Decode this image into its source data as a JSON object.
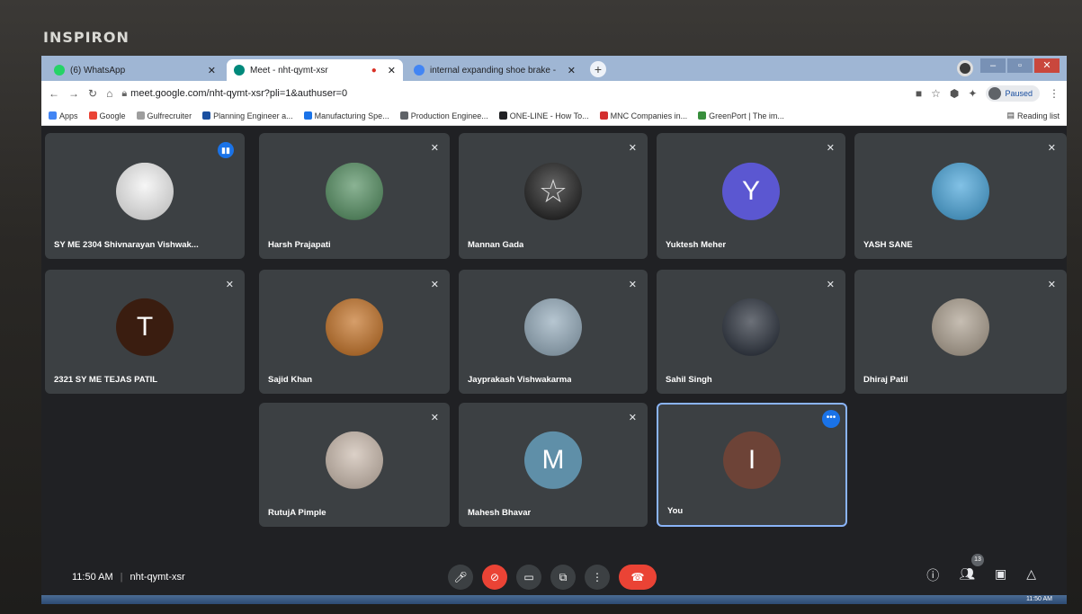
{
  "device": {
    "brand": "INSPIRON"
  },
  "browser": {
    "tabs": [
      {
        "title": "(6) WhatsApp",
        "color": "#25d366"
      },
      {
        "title": "Meet - nht-qymt-xsr",
        "color": "#00897b",
        "recording": "●"
      },
      {
        "title": "internal expanding shoe brake - ",
        "color": "#4285f4"
      }
    ],
    "url": "meet.google.com/nht-qymt-xsr?pli=1&authuser=0",
    "profile_status": "Paused",
    "bookmarks": [
      {
        "label": "Apps",
        "color": "#4285f4"
      },
      {
        "label": "Google",
        "color": "#ea4335"
      },
      {
        "label": "Gulfrecruiter",
        "color": "#9e9e9e"
      },
      {
        "label": "Planning Engineer a...",
        "color": "#1a4fa0"
      },
      {
        "label": "Manufacturing Spe...",
        "color": "#1a73e8"
      },
      {
        "label": "Production Enginee...",
        "color": "#5f6368"
      },
      {
        "label": "ONE-LINE - How To...",
        "color": "#202124"
      },
      {
        "label": "MNC Companies in...",
        "color": "#d32f2f"
      },
      {
        "label": "GreenPort | The im...",
        "color": "#388e3c"
      }
    ],
    "reading_list": "Reading list"
  },
  "meet": {
    "participants": [
      {
        "name": "SY ME 2304 Shivnarayan Vishwak...",
        "avatar": "photo",
        "color": "#f2f2f2",
        "status": "speaking"
      },
      {
        "name": "Harsh Prajapati",
        "avatar": "photo",
        "color": "#4c8a5a",
        "status": "muted"
      },
      {
        "name": "Mannan Gada",
        "avatar": "star-photo",
        "color": "#111111",
        "status": "muted"
      },
      {
        "name": "Yuktesh Meher",
        "avatar": "Y",
        "color": "#5b57d1",
        "status": "muted"
      },
      {
        "name": "YASH SANE",
        "avatar": "photo",
        "color": "#3fa0d8",
        "status": "muted"
      },
      {
        "name": "2321 SY ME TEJAS PATIL",
        "avatar": "T",
        "color": "#3a1d10",
        "status": "muted"
      },
      {
        "name": "Sajid Khan",
        "avatar": "photo",
        "color": "#c06a1a",
        "status": "muted"
      },
      {
        "name": "Jayprakash Vishwakarma",
        "avatar": "photo",
        "color": "#8fa7b8",
        "status": "muted"
      },
      {
        "name": "Sahil Singh",
        "avatar": "photo",
        "color": "#1d2430",
        "status": "muted"
      },
      {
        "name": "Dhiraj Patil",
        "avatar": "photo",
        "color": "#a89b8a",
        "status": "muted"
      },
      {
        "name": "RutujA Pimple",
        "avatar": "photo",
        "color": "#c9b8aa",
        "status": "muted"
      },
      {
        "name": "Mahesh Bhavar",
        "avatar": "M",
        "color": "#5f8fa8",
        "status": "muted"
      },
      {
        "name": "You",
        "avatar": "I",
        "color": "#6d4337",
        "status": "self"
      }
    ],
    "time": "11:50 AM",
    "meeting_code": "nht-qymt-xsr",
    "people_count": "13"
  },
  "taskbar": {
    "clock": "11:50 AM"
  }
}
